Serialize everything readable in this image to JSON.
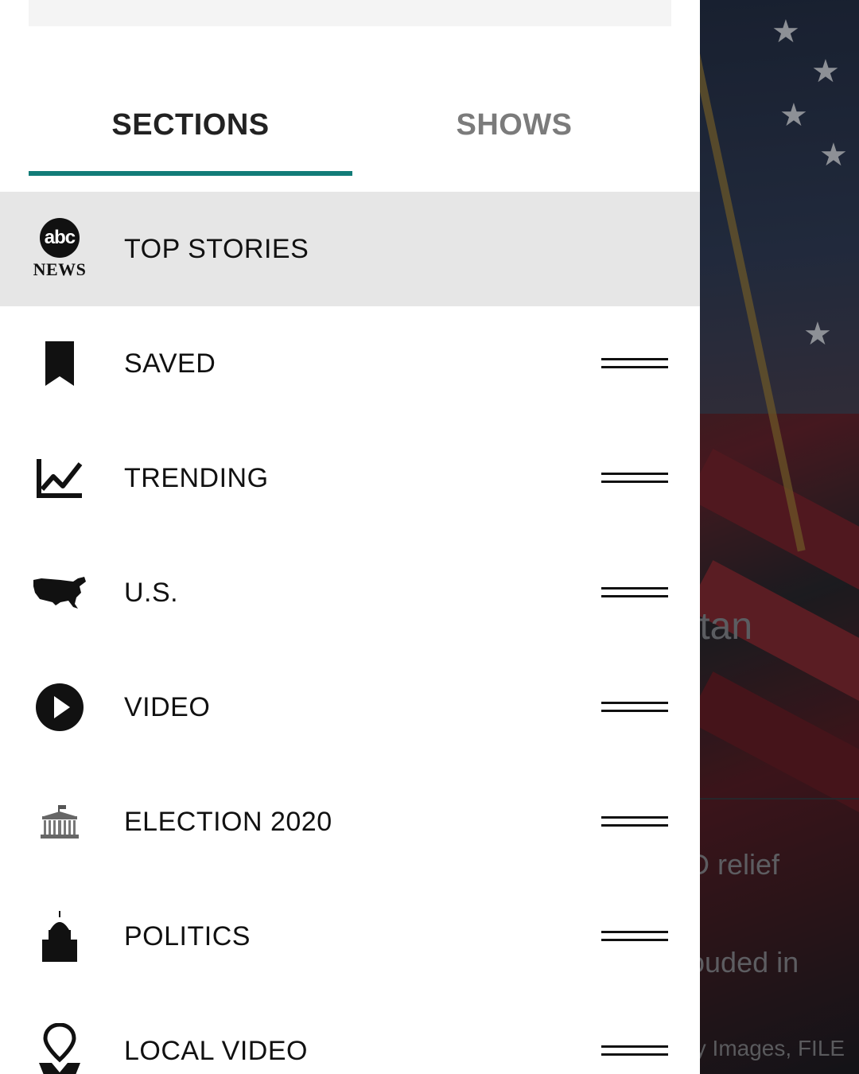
{
  "tabs": [
    {
      "label": "SECTIONS",
      "active": true
    },
    {
      "label": "SHOWS",
      "active": false
    }
  ],
  "sections": [
    {
      "label": "TOP STORIES",
      "icon": "abc-news-logo",
      "selected": true,
      "logo_top": "abc",
      "logo_bottom": "NEWS"
    },
    {
      "label": "SAVED",
      "icon": "bookmark-icon"
    },
    {
      "label": "TRENDING",
      "icon": "trending-chart-icon"
    },
    {
      "label": "U.S.",
      "icon": "us-map-icon"
    },
    {
      "label": "VIDEO",
      "icon": "play-circle-icon"
    },
    {
      "label": "ELECTION 2020",
      "icon": "white-house-icon"
    },
    {
      "label": "POLITICS",
      "icon": "capitol-dome-icon"
    },
    {
      "label": "LOCAL VIDEO",
      "icon": "location-pin-map-icon"
    }
  ],
  "background": {
    "headline_fragment": "ttan",
    "summary_fragment_1": "D relief",
    "summary_fragment_2": "ouded in",
    "credit_fragment": "ty Images, FILE"
  },
  "colors": {
    "accent": "#127c78",
    "selected_row": "#e6e6e6",
    "inactive_tab": "#7b7b7b"
  }
}
